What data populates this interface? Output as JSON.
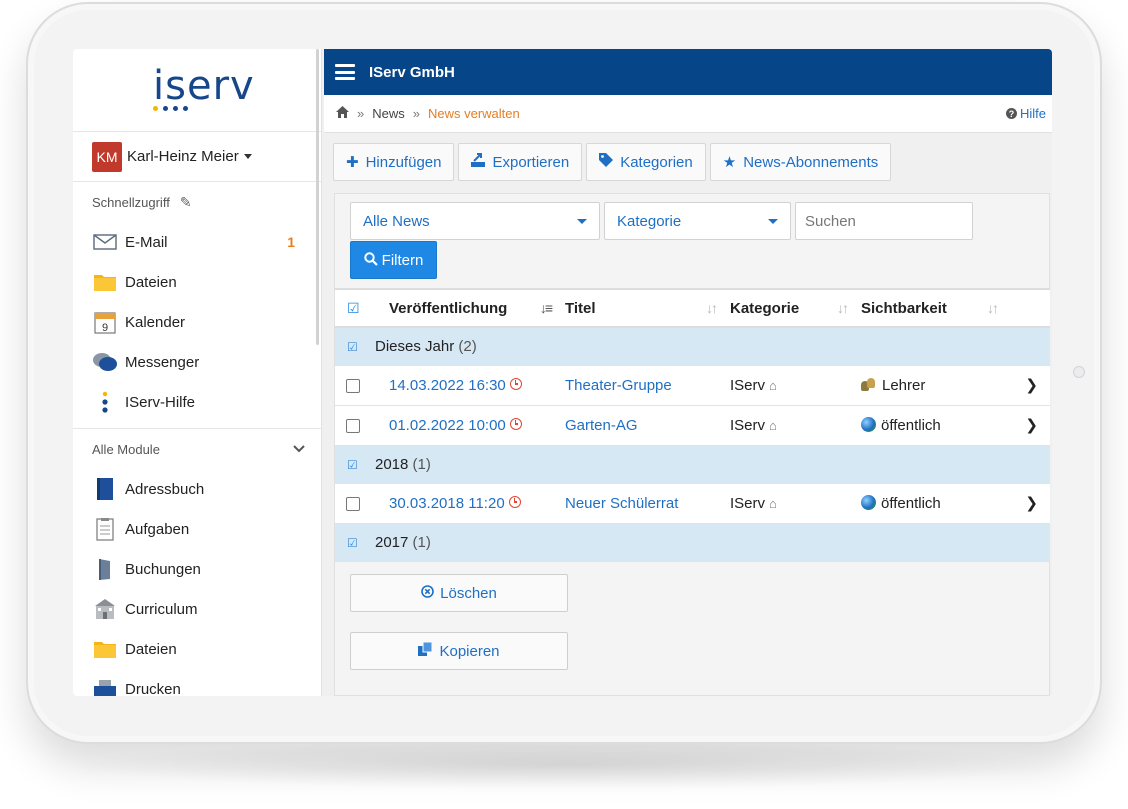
{
  "sidebar": {
    "logo_text": "iserv",
    "logo_dots": [
      "#f2b705",
      "#16478a",
      "#16478a",
      "#16478a"
    ],
    "user": {
      "initials": "KM",
      "name": "Karl-Heinz Meier"
    },
    "quick_access": {
      "title": "Schnellzugriff",
      "items": [
        {
          "label": "E-Mail",
          "icon": "envelope-icon",
          "badge": "1"
        },
        {
          "label": "Dateien",
          "icon": "folder-icon"
        },
        {
          "label": "Kalender",
          "icon": "calendar-icon",
          "icon_text": "9"
        },
        {
          "label": "Messenger",
          "icon": "chat-bubbles-icon"
        },
        {
          "label": "IServ-Hilfe",
          "icon": "help-dots-icon"
        }
      ]
    },
    "all_modules": {
      "title": "Alle Module",
      "items": [
        {
          "label": "Adressbuch",
          "icon": "address-book-icon"
        },
        {
          "label": "Aufgaben",
          "icon": "clipboard-icon"
        },
        {
          "label": "Buchungen",
          "icon": "door-icon"
        },
        {
          "label": "Curriculum",
          "icon": "school-building-icon"
        },
        {
          "label": "Dateien",
          "icon": "folder-icon"
        },
        {
          "label": "Drucken",
          "icon": "printer-icon"
        }
      ]
    }
  },
  "topbar": {
    "title": "IServ GmbH"
  },
  "breadcrumb": {
    "home_icon": "home-icon",
    "items": [
      "News",
      "News verwalten"
    ],
    "help": "Hilfe"
  },
  "toolbar": {
    "add": "Hinzufügen",
    "export": "Exportieren",
    "categories": "Kategorien",
    "subscriptions": "News-Abonnements"
  },
  "filters": {
    "news_select": "Alle News",
    "category_select": "Kategorie",
    "search_placeholder": "Suchen",
    "filter_button": "Filtern"
  },
  "table": {
    "columns": [
      "Veröffentlichung",
      "Titel",
      "Kategorie",
      "Sichtbarkeit"
    ],
    "groups": [
      {
        "label": "Dieses Jahr",
        "count": "(2)",
        "rows": [
          {
            "date": "14.03.2022 16:30",
            "title": "Theater-Gruppe",
            "category": "IServ",
            "visibility": "Lehrer",
            "visibility_icon": "teachers-icon"
          },
          {
            "date": "01.02.2022 10:00",
            "title": "Garten-AG",
            "category": "IServ",
            "visibility": "öffentlich",
            "visibility_icon": "globe-icon"
          }
        ]
      },
      {
        "label": "2018",
        "count": "(1)",
        "rows": [
          {
            "date": "30.03.2018 11:20",
            "title": "Neuer Schülerrat",
            "category": "IServ",
            "visibility": "öffentlich",
            "visibility_icon": "globe-icon"
          }
        ]
      },
      {
        "label": "2017",
        "count": "(1)",
        "rows": []
      }
    ]
  },
  "actions": {
    "delete": "Löschen",
    "copy": "Kopieren"
  },
  "colors": {
    "topbar": "#064587",
    "accent": "#1f6fc5",
    "breadcrumb_current": "#e67e22",
    "group_row": "#d7e8f5",
    "avatar": "#c0392b"
  }
}
